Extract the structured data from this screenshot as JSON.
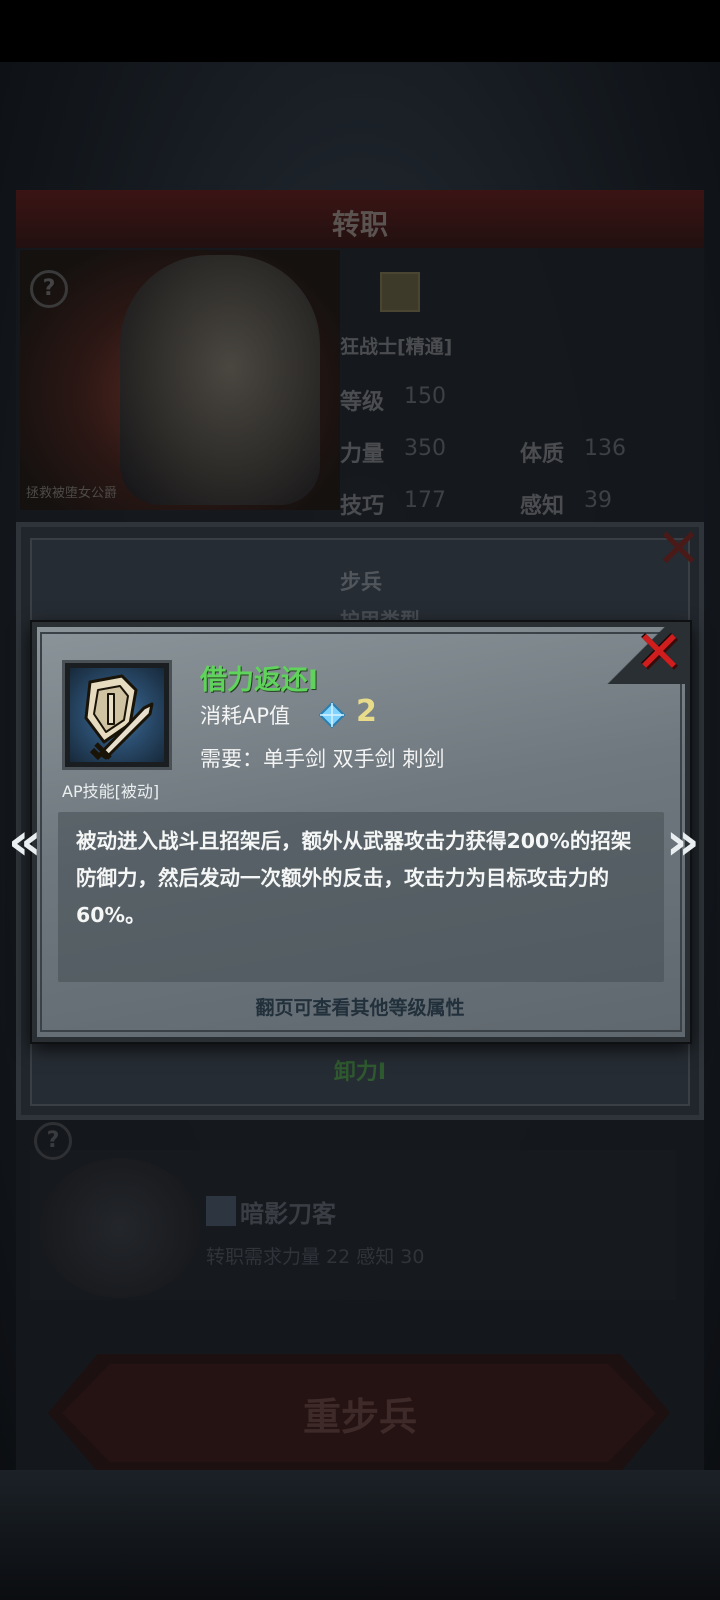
{
  "background": {
    "title": "转职",
    "portrait_caption": "拯救被堕女公爵",
    "current_job": "狂战士[精通]",
    "stats": [
      {
        "label": "等级",
        "value": "150"
      },
      {
        "label": "力量",
        "value": "350"
      },
      {
        "label": "体质",
        "value": "136"
      },
      {
        "label": "技巧",
        "value": "177"
      },
      {
        "label": "感知",
        "value": "39"
      }
    ],
    "other_job": {
      "name": "暗影刀客",
      "requirement": "转职需求力量 22 感知 30"
    },
    "confirm_button": "重步兵",
    "help_glyph": "?"
  },
  "mid_popup": {
    "class_type": "步兵",
    "armor_type": "护甲类型",
    "bottom_skill": "卸力I",
    "close_glyph": "✕"
  },
  "skill_popup": {
    "close_glyph": "✕",
    "icon": "shield-sword-icon",
    "category": "AP技能[被动]",
    "name": "借力返还I",
    "ap_label": "消耗AP值",
    "ap_value": "2",
    "requirement": "需要：单手剑  双手剑  刺剑",
    "description": "被动进入战斗且招架后，额外从武器攻击力获得200%的招架防御力，然后发动一次额外的反击，攻击力为目标攻击力的60%。",
    "page_hint": "翻页可查看其他等级属性",
    "prev_glyph": "«",
    "next_glyph": "»"
  },
  "colors": {
    "skill_name": "#5fd35b",
    "ap_value": "#e8dc8a",
    "close_red": "#d01e1e",
    "gem_blue": "#7fd3ff"
  }
}
